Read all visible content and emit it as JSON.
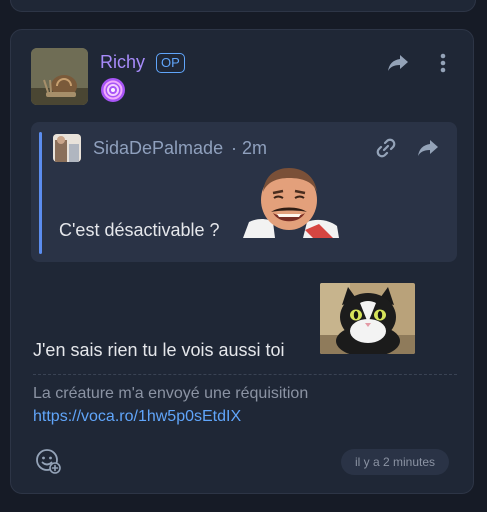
{
  "post": {
    "author": "Richy",
    "author_badge": "OP",
    "flair_icon": "spiral-flair-icon",
    "quote": {
      "author": "SidaDePalmade",
      "time": "· 2m",
      "text": "C'est désactivable ?"
    },
    "message": "J'en sais rien tu le vois aussi toi",
    "edit_note": "La créature m'a envoyé une réquisition",
    "edit_link": "https://voca.ro/1hw5p0sEtdIX",
    "timestamp": "il y a 2 minutes"
  },
  "colors": {
    "background": "#161b26",
    "card": "#1f2736",
    "quote_bg": "#2a3346",
    "accent_blue": "#60a5fa",
    "username_purple": "#a78bfa"
  }
}
